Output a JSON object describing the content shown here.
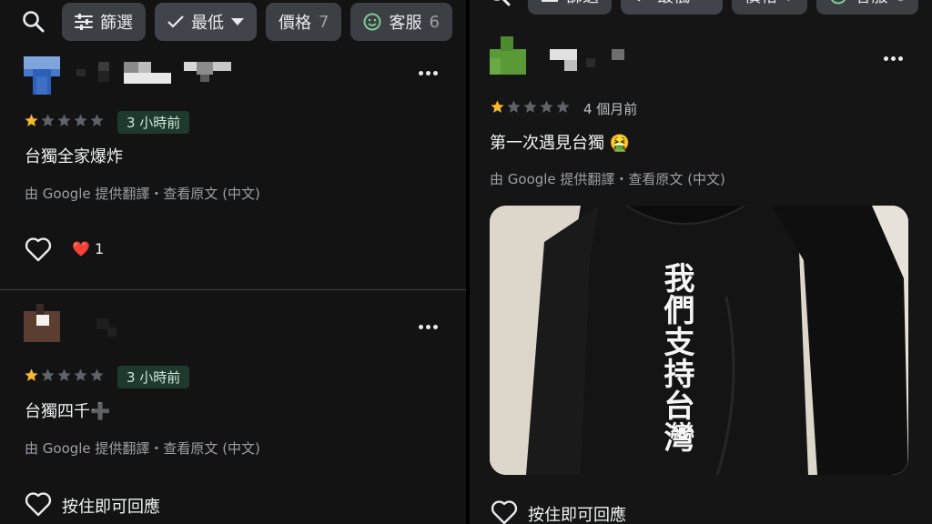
{
  "filters": {
    "filter_label": "篩選",
    "sort_label": "最低",
    "price_label": "價格",
    "price_count": "7",
    "service_label": "客服",
    "service_count": "6"
  },
  "reviews_left": [
    {
      "rating": 1,
      "time": "3 小時前",
      "text": "台獨全家爆炸",
      "translation": "由 Google 提供翻譯・查看原文 (中文)",
      "reaction_emoji": "❤️",
      "reaction_count": "1"
    },
    {
      "rating": 1,
      "time": "3 小時前",
      "text": "台獨四千",
      "text_emoji": "➕",
      "translation": "由 Google 提供翻譯・查看原文 (中文)",
      "reply_label": "按住即可回應"
    }
  ],
  "review_right": {
    "rating": 1,
    "time": "4 個月前",
    "text": "第一次遇見台獨",
    "text_emoji": "🤮",
    "translation": "由 Google 提供翻譯・查看原文 (中文)",
    "photo_text": "我們支持台灣",
    "reply_label": "按住即可回應"
  },
  "colors": {
    "star_filled": "#f6b82c",
    "star_empty": "#5f6368",
    "time_badge_bg": "#1f3a2c",
    "chip_bg": "#3c3f43"
  }
}
